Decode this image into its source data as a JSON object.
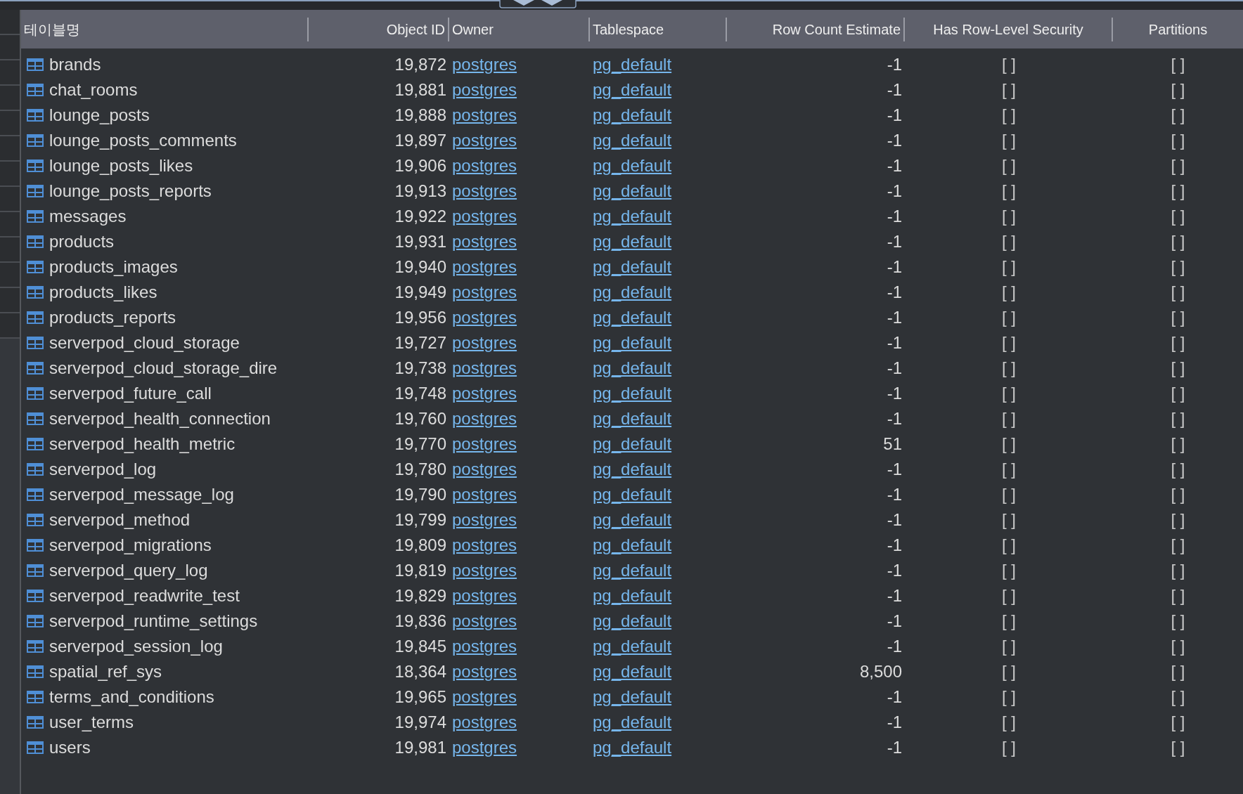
{
  "table": {
    "columns": [
      "테이블명",
      "Object ID",
      "Owner",
      "Tablespace",
      "Row Count Estimate",
      "Has Row-Level Security",
      "Partitions"
    ],
    "rows": [
      {
        "name": "brands",
        "object_id": "19,872",
        "owner": "postgres",
        "tablespace": "pg_default",
        "row_count": "-1",
        "rls": "[ ]",
        "partitions": "[ ]"
      },
      {
        "name": "chat_rooms",
        "object_id": "19,881",
        "owner": "postgres",
        "tablespace": "pg_default",
        "row_count": "-1",
        "rls": "[ ]",
        "partitions": "[ ]"
      },
      {
        "name": "lounge_posts",
        "object_id": "19,888",
        "owner": "postgres",
        "tablespace": "pg_default",
        "row_count": "-1",
        "rls": "[ ]",
        "partitions": "[ ]"
      },
      {
        "name": "lounge_posts_comments",
        "object_id": "19,897",
        "owner": "postgres",
        "tablespace": "pg_default",
        "row_count": "-1",
        "rls": "[ ]",
        "partitions": "[ ]"
      },
      {
        "name": "lounge_posts_likes",
        "object_id": "19,906",
        "owner": "postgres",
        "tablespace": "pg_default",
        "row_count": "-1",
        "rls": "[ ]",
        "partitions": "[ ]"
      },
      {
        "name": "lounge_posts_reports",
        "object_id": "19,913",
        "owner": "postgres",
        "tablespace": "pg_default",
        "row_count": "-1",
        "rls": "[ ]",
        "partitions": "[ ]"
      },
      {
        "name": "messages",
        "object_id": "19,922",
        "owner": "postgres",
        "tablespace": "pg_default",
        "row_count": "-1",
        "rls": "[ ]",
        "partitions": "[ ]"
      },
      {
        "name": "products",
        "object_id": "19,931",
        "owner": "postgres",
        "tablespace": "pg_default",
        "row_count": "-1",
        "rls": "[ ]",
        "partitions": "[ ]"
      },
      {
        "name": "products_images",
        "object_id": "19,940",
        "owner": "postgres",
        "tablespace": "pg_default",
        "row_count": "-1",
        "rls": "[ ]",
        "partitions": "[ ]"
      },
      {
        "name": "products_likes",
        "object_id": "19,949",
        "owner": "postgres",
        "tablespace": "pg_default",
        "row_count": "-1",
        "rls": "[ ]",
        "partitions": "[ ]"
      },
      {
        "name": "products_reports",
        "object_id": "19,956",
        "owner": "postgres",
        "tablespace": "pg_default",
        "row_count": "-1",
        "rls": "[ ]",
        "partitions": "[ ]"
      },
      {
        "name": "serverpod_cloud_storage",
        "object_id": "19,727",
        "owner": "postgres",
        "tablespace": "pg_default",
        "row_count": "-1",
        "rls": "[ ]",
        "partitions": "[ ]"
      },
      {
        "name": "serverpod_cloud_storage_dire",
        "object_id": "19,738",
        "owner": "postgres",
        "tablespace": "pg_default",
        "row_count": "-1",
        "rls": "[ ]",
        "partitions": "[ ]"
      },
      {
        "name": "serverpod_future_call",
        "object_id": "19,748",
        "owner": "postgres",
        "tablespace": "pg_default",
        "row_count": "-1",
        "rls": "[ ]",
        "partitions": "[ ]"
      },
      {
        "name": "serverpod_health_connection",
        "object_id": "19,760",
        "owner": "postgres",
        "tablespace": "pg_default",
        "row_count": "-1",
        "rls": "[ ]",
        "partitions": "[ ]"
      },
      {
        "name": "serverpod_health_metric",
        "object_id": "19,770",
        "owner": "postgres",
        "tablespace": "pg_default",
        "row_count": "51",
        "rls": "[ ]",
        "partitions": "[ ]"
      },
      {
        "name": "serverpod_log",
        "object_id": "19,780",
        "owner": "postgres",
        "tablespace": "pg_default",
        "row_count": "-1",
        "rls": "[ ]",
        "partitions": "[ ]"
      },
      {
        "name": "serverpod_message_log",
        "object_id": "19,790",
        "owner": "postgres",
        "tablespace": "pg_default",
        "row_count": "-1",
        "rls": "[ ]",
        "partitions": "[ ]"
      },
      {
        "name": "serverpod_method",
        "object_id": "19,799",
        "owner": "postgres",
        "tablespace": "pg_default",
        "row_count": "-1",
        "rls": "[ ]",
        "partitions": "[ ]"
      },
      {
        "name": "serverpod_migrations",
        "object_id": "19,809",
        "owner": "postgres",
        "tablespace": "pg_default",
        "row_count": "-1",
        "rls": "[ ]",
        "partitions": "[ ]"
      },
      {
        "name": "serverpod_query_log",
        "object_id": "19,819",
        "owner": "postgres",
        "tablespace": "pg_default",
        "row_count": "-1",
        "rls": "[ ]",
        "partitions": "[ ]"
      },
      {
        "name": "serverpod_readwrite_test",
        "object_id": "19,829",
        "owner": "postgres",
        "tablespace": "pg_default",
        "row_count": "-1",
        "rls": "[ ]",
        "partitions": "[ ]"
      },
      {
        "name": "serverpod_runtime_settings",
        "object_id": "19,836",
        "owner": "postgres",
        "tablespace": "pg_default",
        "row_count": "-1",
        "rls": "[ ]",
        "partitions": "[ ]"
      },
      {
        "name": "serverpod_session_log",
        "object_id": "19,845",
        "owner": "postgres",
        "tablespace": "pg_default",
        "row_count": "-1",
        "rls": "[ ]",
        "partitions": "[ ]"
      },
      {
        "name": "spatial_ref_sys",
        "object_id": "18,364",
        "owner": "postgres",
        "tablespace": "pg_default",
        "row_count": "8,500",
        "rls": "[ ]",
        "partitions": "[ ]"
      },
      {
        "name": "terms_and_conditions",
        "object_id": "19,965",
        "owner": "postgres",
        "tablespace": "pg_default",
        "row_count": "-1",
        "rls": "[ ]",
        "partitions": "[ ]"
      },
      {
        "name": "user_terms",
        "object_id": "19,974",
        "owner": "postgres",
        "tablespace": "pg_default",
        "row_count": "-1",
        "rls": "[ ]",
        "partitions": "[ ]"
      },
      {
        "name": "users",
        "object_id": "19,981",
        "owner": "postgres",
        "tablespace": "pg_default",
        "row_count": "-1",
        "rls": "[ ]",
        "partitions": "[ ]"
      }
    ]
  }
}
